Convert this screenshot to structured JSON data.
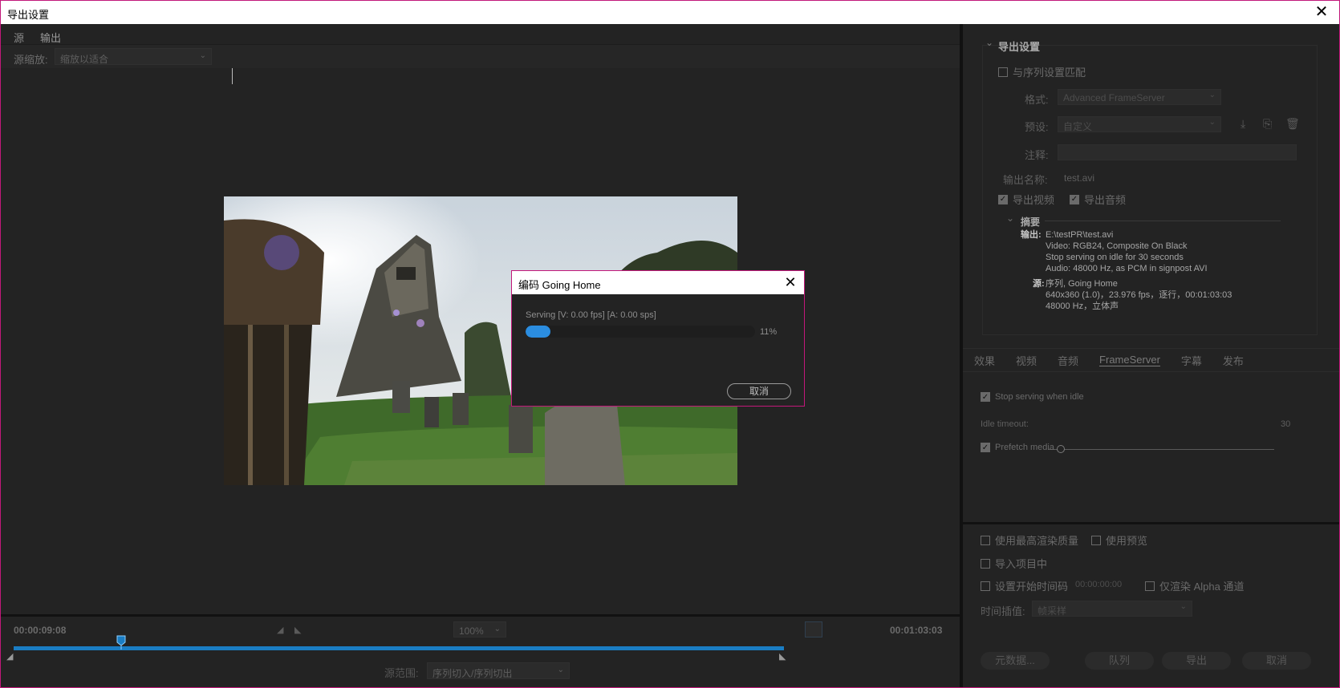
{
  "window": {
    "title": "导出设置",
    "close_glyph": "✕"
  },
  "left": {
    "tabs": [
      {
        "label": "源"
      },
      {
        "label": "输出"
      }
    ],
    "source_scale_label": "源缩放:",
    "source_scale_value": "缩放以适合",
    "timecode_current": "00:00:09:08",
    "timecode_end": "00:01:03:03",
    "zoom_value": "100%",
    "range_label": "源范围:",
    "range_value": "序列切入/序列切出",
    "playhead_fraction": 0.14
  },
  "right": {
    "section_title": "导出设置",
    "match_sequence": {
      "label": "与序列设置匹配",
      "checked": false
    },
    "format_label": "格式:",
    "format_value": "Advanced FrameServer",
    "preset_label": "预设:",
    "preset_value": "自定义",
    "comment_label": "注释:",
    "output_name_label": "输出名称:",
    "output_name_value": "test.avi",
    "export_video": {
      "label": "导出视频",
      "checked": true
    },
    "export_audio": {
      "label": "导出音频",
      "checked": true
    },
    "summary_title": "摘要",
    "summary_output_key": "输出:",
    "summary_output_lines": [
      "E:\\testPR\\test.avi",
      "Video: RGB24, Composite On Black",
      "Stop serving on idle for 30 seconds",
      "Audio: 48000 Hz, as PCM in signpost AVI"
    ],
    "summary_source_key": "源:",
    "summary_source_lines": [
      "序列, Going Home",
      "640x360 (1.0)，23.976 fps，逐行，00:01:03:03",
      "48000 Hz，立体声"
    ],
    "tabs": [
      {
        "label": "效果"
      },
      {
        "label": "视频"
      },
      {
        "label": "音频"
      },
      {
        "label": "FrameServer"
      },
      {
        "label": "字幕"
      },
      {
        "label": "发布"
      }
    ],
    "stop_serving": {
      "label": "Stop serving when idle",
      "checked": true
    },
    "idle_timeout_label": "Idle timeout:",
    "idle_timeout_value": "30",
    "prefetch": {
      "label": "Prefetch media",
      "checked": true
    },
    "max_render": {
      "label": "使用最高渲染质量",
      "checked": false
    },
    "use_preview": {
      "label": "使用预览",
      "checked": false
    },
    "import_project": {
      "label": "导入项目中",
      "checked": false
    },
    "set_start_tc": {
      "label": "设置开始时间码",
      "checked": false
    },
    "start_tc_value": "00:00:00:00",
    "alpha_only": {
      "label": "仅渲染 Alpha 通道",
      "checked": false
    },
    "interp_label": "时间插值:",
    "interp_value": "帧采样",
    "buttons": {
      "metadata": "元数据...",
      "queue": "队列",
      "export": "导出",
      "cancel": "取消"
    }
  },
  "dialog": {
    "title": "编码 Going Home",
    "status": "Serving [V: 0.00 fps] [A: 0.00 sps]",
    "progress_percent": 11,
    "progress_label": "11%",
    "cancel_label": "取消"
  },
  "colors": {
    "accent": "#2b8de0",
    "timeline": "#1a7dc4",
    "window_border": "#c2187a"
  }
}
